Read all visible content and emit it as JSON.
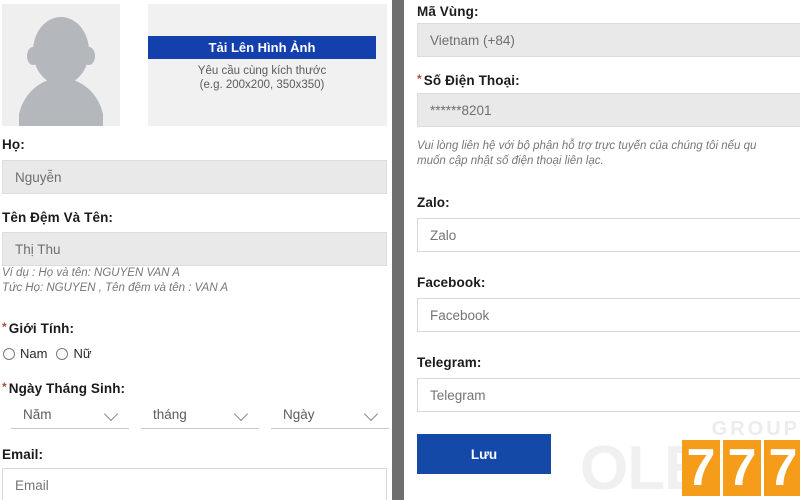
{
  "colors": {
    "primary_blue": "#1340ac",
    "save_blue": "#1549a8",
    "divider_gray": "#6e6e6e",
    "readonly_bg": "#e9e9e9",
    "required_star": "#b34a3d",
    "watermark_orange": "#f59c1a",
    "watermark_gray": "#f0f0f0"
  },
  "left_panel": {
    "avatar": {
      "icon": "user-silhouette-icon"
    },
    "upload": {
      "button_label": "Tải Lên Hình Ảnh",
      "hint_line1": "Yêu cầu cùng kích thước",
      "hint_line2": "(e.g. 200x200, 350x350)"
    },
    "fields": {
      "surname": {
        "label": "Họ:",
        "value": "Nguyễn",
        "readonly": true
      },
      "middle_and_given_name": {
        "label": "Tên Đệm Và Tên:",
        "value": "Thị Thu",
        "readonly": true,
        "helper_line1": "Ví dụ : Họ và tên: NGUYEN VAN A",
        "helper_line2": "Tức Họ: NGUYEN , Tên đệm và tên : VAN A"
      },
      "gender": {
        "label": "Giới Tính:",
        "required": true,
        "required_marker": "*",
        "options": [
          {
            "label": "Nam",
            "selected": false
          },
          {
            "label": "Nữ",
            "selected": false
          }
        ]
      },
      "birthday": {
        "label": "Ngày Tháng Sinh:",
        "required": true,
        "required_marker": "*",
        "selects": [
          {
            "name": "year",
            "value": "Năm"
          },
          {
            "name": "month",
            "value": "tháng"
          },
          {
            "name": "day",
            "value": "Ngày"
          }
        ]
      },
      "email": {
        "label": "Email:",
        "placeholder": "Email",
        "value": ""
      }
    }
  },
  "right_panel": {
    "fields": {
      "area_code": {
        "label": "Mã Vùng:",
        "value": "Vietnam (+84)",
        "readonly": true
      },
      "phone": {
        "label": "Số Điện Thoại:",
        "required": true,
        "required_marker": "*",
        "value": "******8201",
        "readonly": true,
        "note_line1": "Vui lòng liên hệ với bộ phận hỗ trợ trực tuyến của chúng tôi nếu qu",
        "note_line2": "muốn cập nhật số điện thoại liên lạc."
      },
      "zalo": {
        "label": "Zalo:",
        "placeholder": "Zalo",
        "value": ""
      },
      "facebook": {
        "label": "Facebook:",
        "placeholder": "Facebook",
        "value": ""
      },
      "telegram": {
        "label": "Telegram:",
        "placeholder": "Telegram",
        "value": ""
      }
    },
    "save_button": {
      "label": "Lưu"
    },
    "watermark": {
      "group_text": "GROUP",
      "brand_text": "OLE",
      "digits": [
        "7",
        "7",
        "7"
      ]
    }
  }
}
